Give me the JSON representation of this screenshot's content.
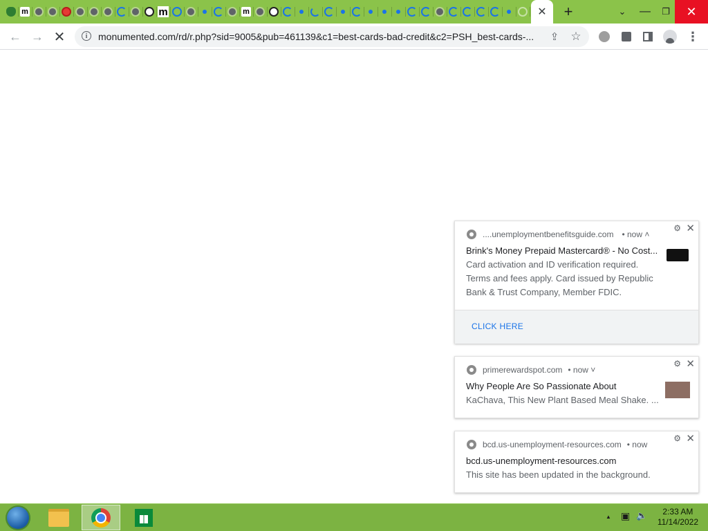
{
  "window": {
    "tab_favicons": [
      "frog",
      "m",
      "globe",
      "globe",
      "red",
      "globe",
      "globe",
      "globe",
      "spin",
      "globe",
      "eye",
      "bigm",
      "ring",
      "globe",
      "dot",
      "spin",
      "globe",
      "m",
      "globe",
      "eye",
      "spin",
      "dot",
      "spin-open",
      "spin",
      "dot",
      "spin",
      "dot",
      "dot",
      "dot",
      "spin",
      "spin",
      "globe",
      "spin",
      "spin",
      "spin",
      "spin",
      "dot",
      "fade"
    ],
    "active_tab_close": "✕",
    "new_tab_label": "+",
    "controls": {
      "search": "⌄",
      "minimize": "—",
      "restore": "❐",
      "close": "✕"
    }
  },
  "toolbar": {
    "back": "←",
    "forward": "→",
    "stop": "✕",
    "info_symbol": "i",
    "url": "monumented.com/rd/r.php?sid=9005&pub=461139&c1=best-cards-bad-credit&c2=PSH_best-cards-...",
    "share": "⇪",
    "star": "☆",
    "menu": "⋮"
  },
  "notifications": [
    {
      "source": "....unemploymentbenefitsguide.com",
      "time": "• now ˄",
      "title": "Brink's Money Prepaid Mastercard® - No Cost...",
      "body_lines": [
        "Card activation and ID verification required.",
        "Terms and fees apply. Card issued by Republic",
        "Bank & Trust Company, Member FDIC."
      ],
      "action": "CLICK HERE",
      "thumb_color": "#111111"
    },
    {
      "source": "primerewardspot.com",
      "time": "• now ˅",
      "title": "Why People Are So Passionate About",
      "body_lines": [
        "KaChava, This New Plant Based Meal Shake. ..."
      ],
      "thumb_color": "#8d6e63"
    },
    {
      "source": "bcd.us-unemployment-resources.com",
      "time": "• now",
      "title": "bcd.us-unemployment-resources.com",
      "body_lines": [
        "This site has been updated in the background."
      ]
    }
  ],
  "notification_icons": {
    "gear": "⚙",
    "close": "✕"
  },
  "taskbar": {
    "tray_arrow": "▲",
    "network": "▣",
    "volume": "🔈",
    "time": "2:33 AM",
    "date": "11/14/2022"
  }
}
